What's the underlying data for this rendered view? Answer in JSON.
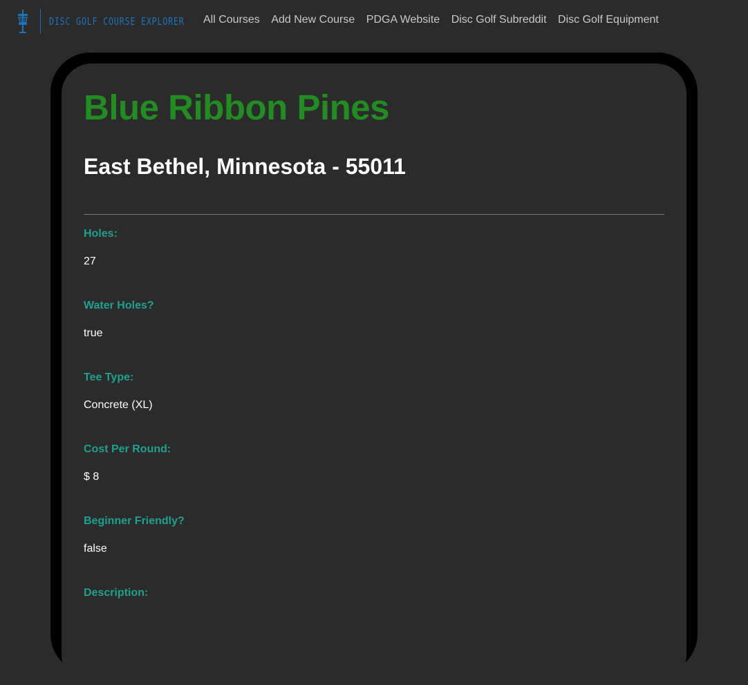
{
  "navbar": {
    "brand_text": "Disc Golf Course Explorer",
    "brand_icon": "disc-golf-basket-icon",
    "links": [
      "All Courses",
      "Add New Course",
      "PDGA Website",
      "Disc Golf Subreddit",
      "Disc Golf Equipment"
    ]
  },
  "course": {
    "name": "Blue Ribbon Pines",
    "location": "East Bethel, Minnesota - 55011",
    "fields": [
      {
        "label": "Holes:",
        "value": "27"
      },
      {
        "label": "Water Holes?",
        "value": "true"
      },
      {
        "label": "Tee Type:",
        "value": "Concrete (XL)"
      },
      {
        "label": "Cost Per Round:",
        "value": "$ 8"
      },
      {
        "label": "Beginner Friendly?",
        "value": "false"
      },
      {
        "label": "Description:",
        "value": ""
      }
    ]
  },
  "colors": {
    "background": "#2b2b2b",
    "title": "#228b22",
    "label": "#20a090",
    "brand": "#1f73b8",
    "card_border": "#000000"
  }
}
